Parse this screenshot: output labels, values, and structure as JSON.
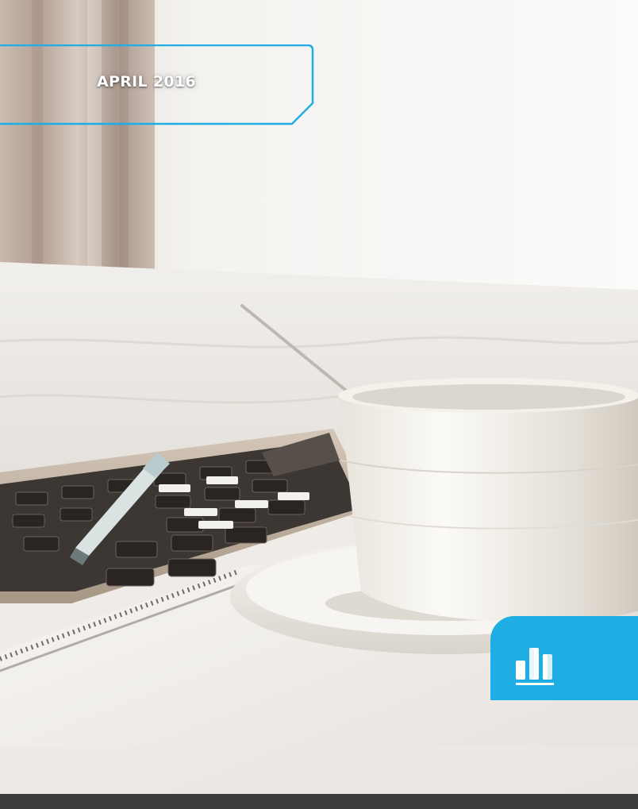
{
  "cover": {
    "date_label": "APRIL 2016",
    "logo_icon": "bar-chart-logo-icon",
    "accent_color": "#1faee3"
  }
}
